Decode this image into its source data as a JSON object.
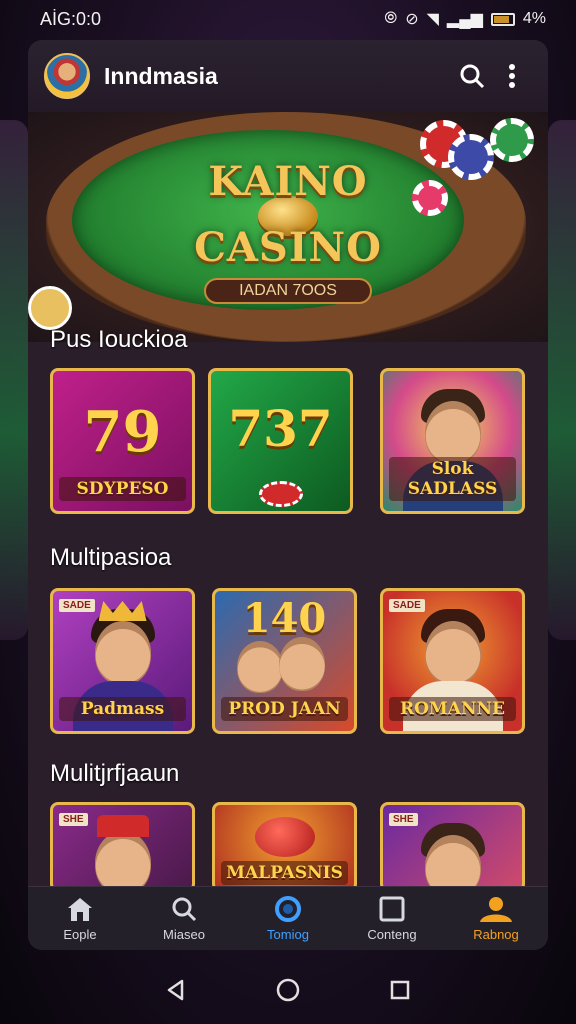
{
  "status_bar": {
    "time": "AİG:0:0",
    "battery": "4%"
  },
  "app_bar": {
    "title": "Inndmasia"
  },
  "hero": {
    "line1": "KAINO",
    "line2": "CASINO",
    "badge": "IADAN 7OOS"
  },
  "sections": [
    {
      "title": "Pus Iouckioa"
    },
    {
      "title": "Multipasioa"
    },
    {
      "title": "Mulitjrfjaaun"
    }
  ],
  "row1": [
    {
      "big": "79",
      "label": "SDYPESO"
    },
    {
      "big": "737",
      "label": ""
    },
    {
      "label": "Slok SADLASS"
    }
  ],
  "row2": [
    {
      "tag": "SADE",
      "label": "Padmass"
    },
    {
      "big": "140",
      "label": "PROD JAAN"
    },
    {
      "tag": "SADE",
      "label": "ROMANNE"
    }
  ],
  "row3": [
    {
      "tag": "SHE",
      "label": ""
    },
    {
      "label": "MALPASNIS"
    },
    {
      "tag": "SHE",
      "label": ""
    }
  ],
  "bottom_nav": [
    {
      "label": "Eople",
      "icon": "home-icon"
    },
    {
      "label": "Miaseo",
      "icon": "search-icon"
    },
    {
      "label": "Tomiog",
      "icon": "circle-icon"
    },
    {
      "label": "Conteng",
      "icon": "square-icon"
    },
    {
      "label": "Rabnog",
      "icon": "profile-icon"
    }
  ],
  "colors": {
    "accent_blue": "#3fa0ff",
    "accent_orange": "#f2a21f",
    "gold": "#e8b84a"
  }
}
